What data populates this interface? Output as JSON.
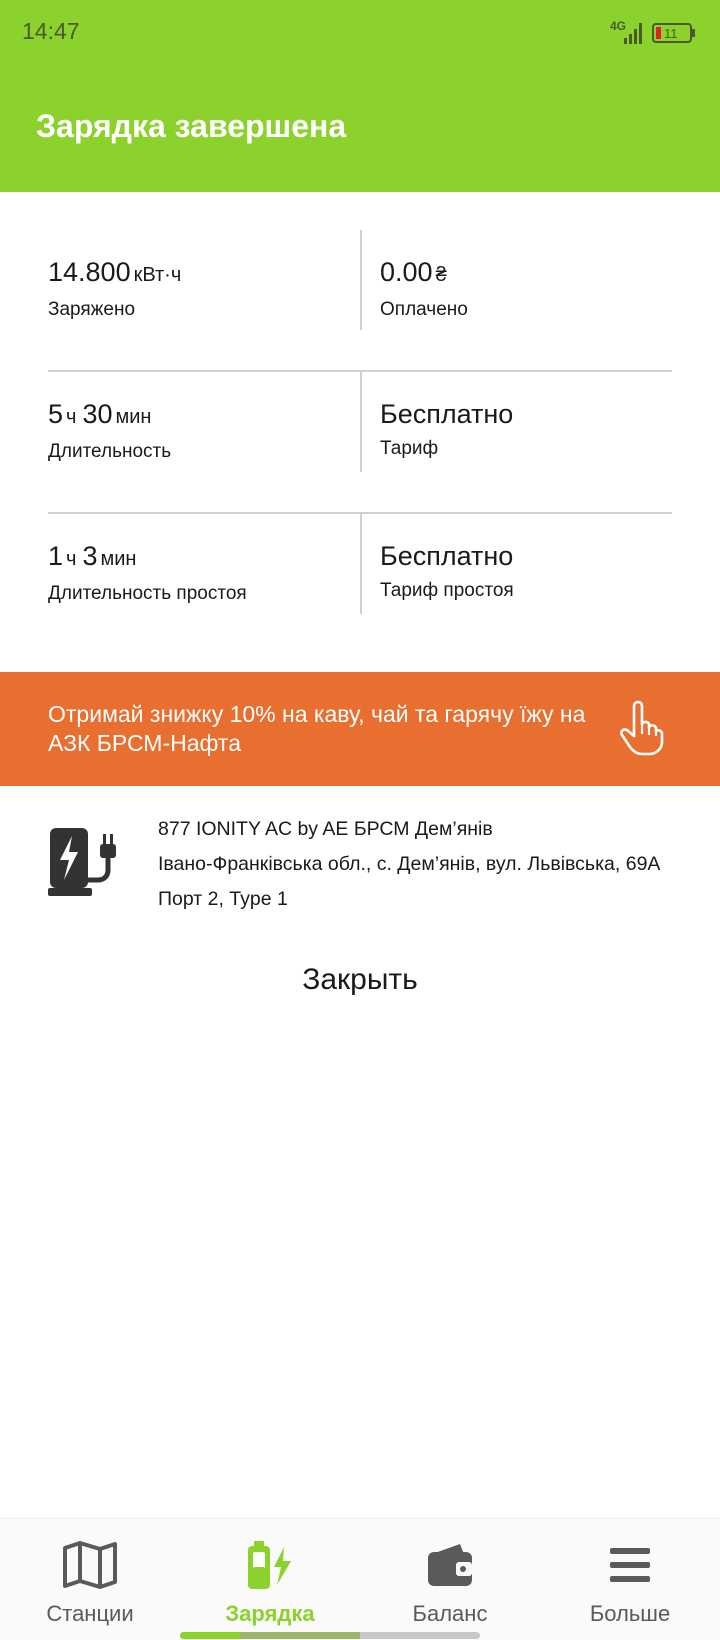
{
  "status_bar": {
    "time": "14:47",
    "network": "4G",
    "battery": "11"
  },
  "header": {
    "title": "Зарядка завершена"
  },
  "stats": {
    "charged": {
      "value": "14.800",
      "unit": "кВт·ч",
      "label": "Заряжено"
    },
    "paid": {
      "value": "0.00",
      "unit": "₴",
      "label": "Оплачено"
    },
    "duration": {
      "hours": "5",
      "hours_unit": "ч",
      "minutes": "30",
      "minutes_unit": "мин",
      "label": "Длительность"
    },
    "tariff": {
      "value": "Бесплатно",
      "label": "Тариф"
    },
    "idle_duration": {
      "hours": "1",
      "hours_unit": "ч",
      "minutes": "3",
      "minutes_unit": "мин",
      "label": "Длительность простоя"
    },
    "idle_tariff": {
      "value": "Бесплатно",
      "label": "Тариф простоя"
    }
  },
  "promo": {
    "text": "Отримай знижку 10% на каву, чай та гарячу їжу на АЗК БРСМ-Нафта",
    "icon": "pointing-hand-icon"
  },
  "station": {
    "name": "877 IONITY AC by AE БРСМ Дем’янів",
    "address": "Івано-Франківська обл., с. Дем’янів, вул. Львівська, 69А",
    "port": "Порт 2, Type 1",
    "icon": "charging-station-icon"
  },
  "close_label": "Закрыть",
  "nav": {
    "items": [
      {
        "label": "Станции",
        "icon": "map-icon",
        "active": false
      },
      {
        "label": "Зарядка",
        "icon": "battery-charging-icon",
        "active": true
      },
      {
        "label": "Баланс",
        "icon": "wallet-icon",
        "active": false
      },
      {
        "label": "Больше",
        "icon": "menu-icon",
        "active": false
      }
    ]
  },
  "colors": {
    "header_green": "#8cd22c",
    "promo_orange": "#e86f30",
    "active_nav": "#8cd22c"
  }
}
